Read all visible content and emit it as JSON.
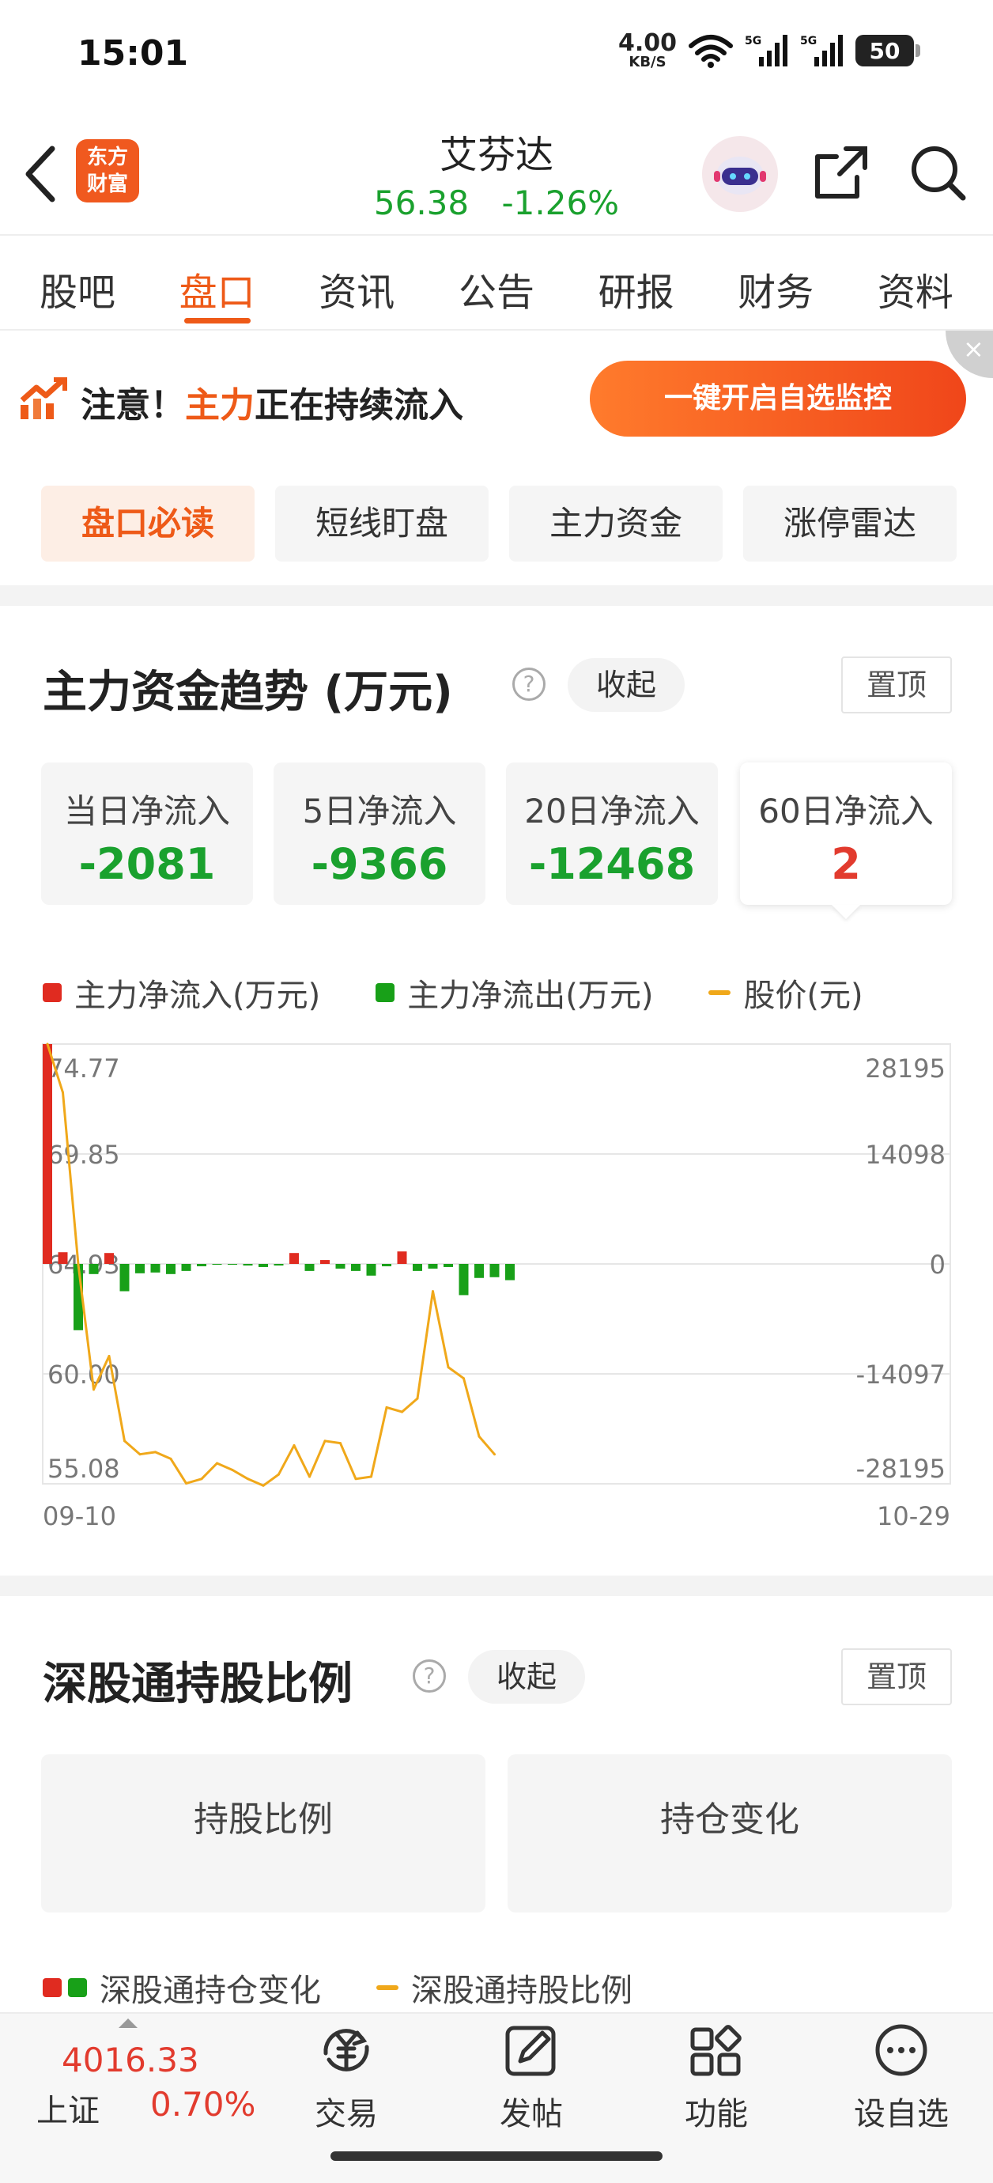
{
  "status": {
    "time": "15:01",
    "net_speed": "4.00",
    "net_unit": "KB/S",
    "battery": "50"
  },
  "header": {
    "logo": [
      "东方",
      "财富"
    ],
    "stock_name": "艾芬达",
    "price": "56.38",
    "change": "-1.26%"
  },
  "tabs": [
    {
      "label": "股吧"
    },
    {
      "label": "盘口",
      "active": true
    },
    {
      "label": "资讯"
    },
    {
      "label": "公告"
    },
    {
      "label": "研报"
    },
    {
      "label": "财务"
    },
    {
      "label": "资料"
    }
  ],
  "alert": {
    "prefix": "注意！",
    "highlight": "主力",
    "suffix": "正在持续流入",
    "button": "一键开启自选监控",
    "close": "×"
  },
  "subtabs": [
    {
      "label": "盘口必读",
      "active": true
    },
    {
      "label": "短线盯盘"
    },
    {
      "label": "主力资金"
    },
    {
      "label": "涨停雷达"
    }
  ],
  "fund_section": {
    "title": "主力资金趋势 (万元)",
    "help": "?",
    "collapse": "收起",
    "pin": "置顶",
    "cards": [
      {
        "label": "当日净流入",
        "value": "-2081"
      },
      {
        "label": "5日净流入",
        "value": "-9366"
      },
      {
        "label": "20日净流入",
        "value": "-12468"
      },
      {
        "label": "60日净流入",
        "value": "2"
      }
    ],
    "legend": [
      "主力净流入(万元)",
      "主力净流出(万元)",
      "股价(元)"
    ]
  },
  "chart_data": {
    "type": "bar",
    "title": "",
    "xlabel": "",
    "ylabel": "",
    "x_range": [
      "09-10",
      "10-29"
    ],
    "left_axis_ticks": [
      "74.77",
      "69.85",
      "64.93",
      "60.00",
      "55.08"
    ],
    "right_axis_ticks": [
      "28195",
      "14098",
      "0",
      "-14097",
      "-28195"
    ],
    "price_ylim": [
      55.08,
      74.77
    ],
    "flow_ylim": [
      -28195,
      28195
    ],
    "colors": {
      "inflow": "#e02b20",
      "outflow": "#18a018",
      "price": "#f0a81a"
    },
    "series": [
      {
        "name": "主力净流入(万元)/主力净流出(万元)",
        "values": [
          28195,
          1500,
          -8500,
          -1300,
          1400,
          -3500,
          -1200,
          -1100,
          -1300,
          -900,
          -300,
          -100,
          -100,
          -200,
          -400,
          -200,
          1400,
          -900,
          500,
          -600,
          -900,
          -1500,
          -300,
          1600,
          -900,
          -600,
          -400,
          -4000,
          -1800,
          -1700,
          -2081
        ]
      },
      {
        "name": "股价(元)",
        "values": [
          74.77,
          72.6,
          64.9,
          59.3,
          60.8,
          57.0,
          56.4,
          56.5,
          56.2,
          55.1,
          55.3,
          56.0,
          55.7,
          55.3,
          55.0,
          55.5,
          56.8,
          55.4,
          57.0,
          56.9,
          55.3,
          55.4,
          58.5,
          58.3,
          58.9,
          63.7,
          60.3,
          59.8,
          57.2,
          56.4
        ]
      }
    ]
  },
  "hk_section": {
    "title": "深股通持股比例",
    "help": "?",
    "collapse": "收起",
    "pin": "置顶",
    "panels": [
      "持股比例",
      "持仓变化"
    ],
    "legend": [
      "深股通持仓变化",
      "深股通持股比例"
    ]
  },
  "bottom": {
    "index_value": "4016.33",
    "index_name": "上证",
    "index_change": "0.70%",
    "nav": [
      {
        "label": "交易",
        "icon": "yuan-refresh-icon"
      },
      {
        "label": "发帖",
        "icon": "edit-icon"
      },
      {
        "label": "功能",
        "icon": "grid-icon"
      },
      {
        "label": "设自选",
        "icon": "more-icon"
      }
    ]
  }
}
